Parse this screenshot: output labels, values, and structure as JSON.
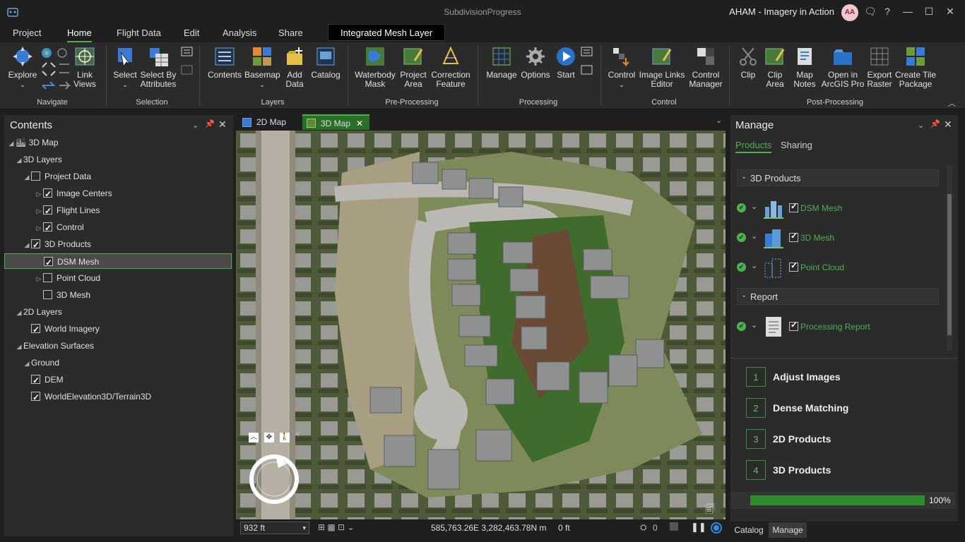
{
  "window": {
    "title": "SubdivisionProgress",
    "user": "AHAM - Imagery in Action",
    "avatar_initials": "AA"
  },
  "menu": {
    "tabs": [
      "Project",
      "Home",
      "Flight Data",
      "Edit",
      "Analysis",
      "Share"
    ],
    "active": "Home",
    "context_tab": "Integrated Mesh Layer"
  },
  "ribbon": {
    "explore": "Explore",
    "link_views": "Link Views",
    "navigate": "Navigate",
    "select": "Select",
    "select_by_attributes": "Select By Attributes",
    "selection": "Selection",
    "contents": "Contents",
    "basemap": "Basemap",
    "add_data": "Add Data",
    "catalog": "Catalog",
    "layers": "Layers",
    "waterbody_mask": "Waterbody Mask",
    "project_area": "Project Area",
    "correction_feature": "Correction Feature",
    "pre_processing": "Pre-Processing",
    "manage": "Manage",
    "options": "Options",
    "start": "Start",
    "processing": "Processing",
    "control": "Control",
    "image_links_editor": "Image Links Editor",
    "control_manager": "Control Manager",
    "control_group": "Control",
    "clip": "Clip",
    "clip_area": "Clip Area",
    "map_notes": "Map Notes",
    "open_in_arcgis_pro": "Open in ArcGIS Pro",
    "export_raster": "Export Raster",
    "create_tile_package": "Create Tile Package",
    "post_processing": "Post-Processing"
  },
  "contents": {
    "title": "Contents",
    "items": [
      {
        "label": "3D Map",
        "level": 0,
        "expander": "open",
        "checkbox": null
      },
      {
        "label": "3D Layers",
        "level": 1,
        "expander": "open",
        "checkbox": null
      },
      {
        "label": "Project Data",
        "level": 2,
        "expander": "open",
        "checkbox": false
      },
      {
        "label": "Image Centers",
        "level": 3,
        "expander": "closed",
        "checkbox": true
      },
      {
        "label": "Flight Lines",
        "level": 3,
        "expander": "closed",
        "checkbox": true
      },
      {
        "label": "Control",
        "level": 3,
        "expander": "closed",
        "checkbox": true
      },
      {
        "label": "3D Products",
        "level": 2,
        "expander": "open",
        "checkbox": true
      },
      {
        "label": "DSM Mesh",
        "level": 3,
        "expander": null,
        "checkbox": true,
        "selected": true
      },
      {
        "label": "Point Cloud",
        "level": 3,
        "expander": "closed",
        "checkbox": false
      },
      {
        "label": "3D Mesh",
        "level": 3,
        "expander": null,
        "checkbox": false
      },
      {
        "label": "2D Layers",
        "level": 1,
        "expander": "open",
        "checkbox": null
      },
      {
        "label": "World Imagery",
        "level": 2,
        "expander": null,
        "checkbox": true
      },
      {
        "label": "Elevation Surfaces",
        "level": 1,
        "expander": "open",
        "checkbox": null
      },
      {
        "label": "Ground",
        "level": 2,
        "expander": "open",
        "checkbox": null
      },
      {
        "label": "DEM",
        "level": 2,
        "expander": null,
        "checkbox": true
      },
      {
        "label": "WorldElevation3D/Terrain3D",
        "level": 2,
        "expander": null,
        "checkbox": true
      }
    ]
  },
  "views": {
    "tabs": [
      "2D Map",
      "3D Map"
    ],
    "active": "3D Map"
  },
  "status": {
    "scale": "932 ft",
    "coords": "585,763.26E 3,282,463.78N m",
    "elevation": "0 ft",
    "selected_count": "0"
  },
  "manage": {
    "title": "Manage",
    "tabs": [
      "Products",
      "Sharing"
    ],
    "active_tab": "Products",
    "sections": {
      "products3d": "3D Products",
      "report": "Report"
    },
    "products": [
      "DSM Mesh",
      "3D Mesh",
      "Point Cloud"
    ],
    "report_item": "Processing Report",
    "steps": [
      {
        "num": "1",
        "label": "Adjust Images"
      },
      {
        "num": "2",
        "label": "Dense Matching"
      },
      {
        "num": "3",
        "label": "2D Products"
      },
      {
        "num": "4",
        "label": "3D Products"
      }
    ],
    "progress_label": "100%",
    "progress_value": 1.0
  },
  "bottom_tabs": [
    "Catalog",
    "Manage"
  ],
  "bottom_tabs_active": "Manage",
  "colors": {
    "accent": "#4caf50",
    "progress": "#2e8b2e"
  }
}
